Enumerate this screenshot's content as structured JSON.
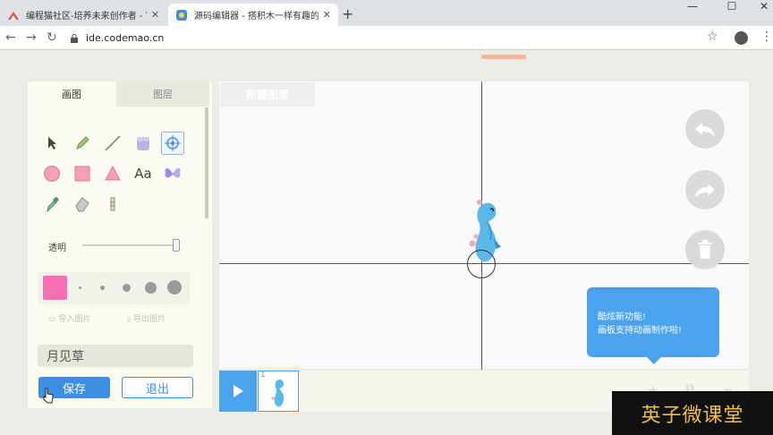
{
  "browser": {
    "tabs": [
      {
        "title": "编程猫社区-培养未来创作者 - 富",
        "active": false
      },
      {
        "title": "源码编辑器 - 搭积木一样有趣的",
        "active": true
      }
    ],
    "new_tab": "+",
    "close": "✕",
    "window": {
      "minimize": "—",
      "maximize": "☐",
      "close": "✕"
    },
    "url": "ide.codemao.cn"
  },
  "panel": {
    "tabs": [
      "画图",
      "图层"
    ],
    "tools": [
      "select-icon",
      "pencil-icon",
      "line-icon",
      "fill-icon",
      "reshape-icon",
      "ellipse-icon",
      "rectangle-icon",
      "triangle-icon",
      "text-icon",
      "butterfly-icon",
      "eyedropper-icon",
      "eraser-icon",
      "crop-icon"
    ],
    "text_tool_label": "Aa",
    "opacity_label": "透明",
    "opacity": 1.0,
    "fill_color": "#f56fb5",
    "import_label": "导入图片",
    "export_label": "导出图片",
    "costume_name": "月见草",
    "save_label": "保存",
    "exit_label": "退出"
  },
  "canvas": {
    "new_layer_label": "新建图层",
    "tip_line1": "酷炫新功能!",
    "tip_line2": "画板支持动画制作啦!"
  },
  "timeline": {
    "frame_number": "1"
  },
  "watermark": "英子微课堂",
  "colors": {
    "accent": "#3d8de0",
    "tooltip": "#4aa3ec",
    "pink": "#f56fb5"
  }
}
